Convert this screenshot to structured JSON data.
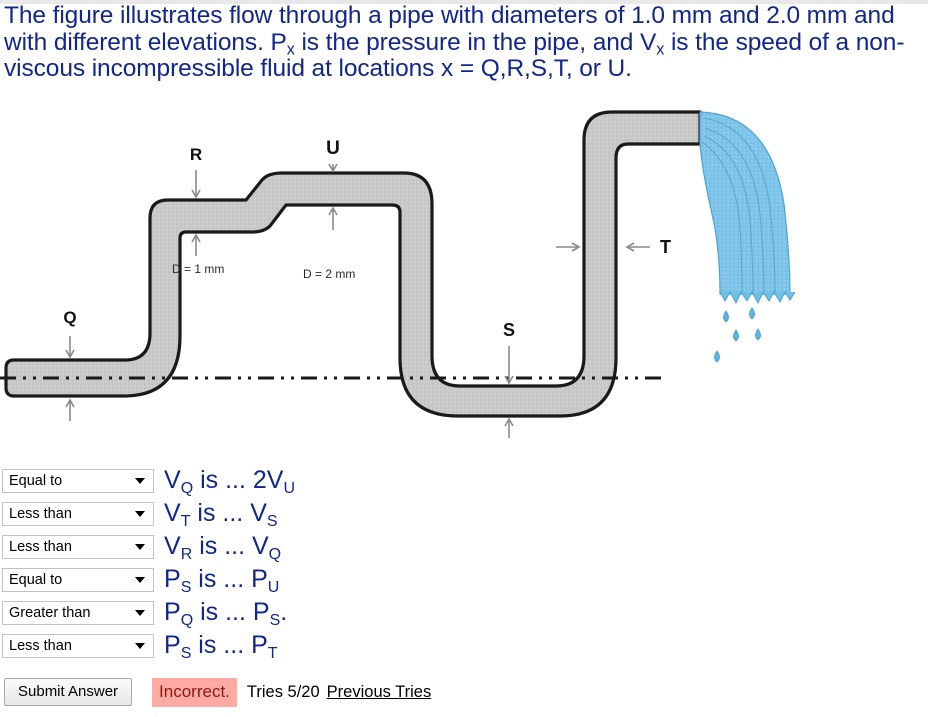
{
  "statement": {
    "line1_a": "The figure illustrates flow through a pipe with diameters of 1.0 mm",
    "line1_b": "and 2.0 mm and with different elevations. P",
    "sub_x1": "x",
    "line1_c": " is the pressure in the",
    "line2_a": "pipe, and V",
    "sub_x2": "x",
    "line2_b": " is the speed of a non-viscous incompressible fluid at",
    "line3": "locations x = Q,R,S,T, or U."
  },
  "figure": {
    "labels": {
      "Q": "Q",
      "R": "R",
      "S": "S",
      "T": "T",
      "U": "U"
    },
    "dimensions": {
      "narrow": "D = 1 mm",
      "wide": "D = 2 mm"
    },
    "colors": {
      "pipe_fill": "#c8c6c4",
      "pipe_outline": "#1a1a16",
      "water": "#6ec0e8",
      "water_outline": "#3f9fd0",
      "datum_line": "#1a1a1a"
    }
  },
  "answers": [
    {
      "selected": "Equal to",
      "left": "V",
      "left_sub": "Q",
      "relation": " is ... ",
      "right": "2V",
      "right_sub": "U",
      "tail": ""
    },
    {
      "selected": "Less than",
      "left": "V",
      "left_sub": "T",
      "relation": " is ... ",
      "right": "V",
      "right_sub": "S",
      "tail": ""
    },
    {
      "selected": "Less than",
      "left": "V",
      "left_sub": "R",
      "relation": " is ... ",
      "right": "V",
      "right_sub": "Q",
      "tail": ""
    },
    {
      "selected": "Equal to",
      "left": "P",
      "left_sub": "S",
      "relation": " is ... ",
      "right": "P",
      "right_sub": "U",
      "tail": ""
    },
    {
      "selected": "Greater than",
      "left": "P",
      "left_sub": "Q",
      "relation": " is ... ",
      "right": "P",
      "right_sub": "S",
      "tail": "."
    },
    {
      "selected": "Less than",
      "left": "P",
      "left_sub": "S",
      "relation": " is ... ",
      "right": "P",
      "right_sub": "T",
      "tail": ""
    }
  ],
  "select_options": [
    "Greater than",
    "Less than",
    "Equal to"
  ],
  "footer": {
    "submit_label": "Submit Answer",
    "status": "Incorrect.",
    "tries": "Tries 5/20",
    "previous_tries": "Previous Tries",
    "status_bg": "#ffaba3",
    "status_fg": "#8d1616"
  }
}
